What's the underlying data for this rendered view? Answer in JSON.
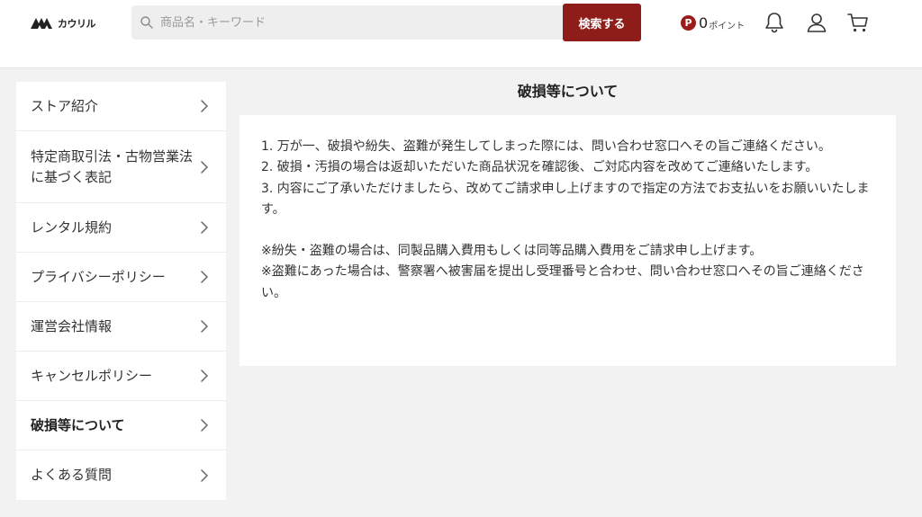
{
  "header": {
    "logo_text": "カウリル",
    "search_placeholder": "商品名・キーワード",
    "search_button": "検索する",
    "points_badge": "P",
    "points_value": "0",
    "points_unit": "ポイント"
  },
  "sidebar": {
    "items": [
      {
        "label": "ストア紹介"
      },
      {
        "label": "特定商取引法・古物営業法に基づく表記"
      },
      {
        "label": "レンタル規約"
      },
      {
        "label": "プライバシーポリシー"
      },
      {
        "label": "運営会社情報"
      },
      {
        "label": "キャンセルポリシー"
      },
      {
        "label": "破損等について"
      },
      {
        "label": "よくある質問"
      }
    ],
    "active_index": 6
  },
  "main": {
    "title": "破損等について",
    "paragraphs": [
      "1. 万が一、破損や紛失、盗難が発生してしまった際には、問い合わせ窓口へその旨ご連絡ください。",
      "2. 破損・汚損の場合は返却いただいた商品状況を確認後、ご対応内容を改めてご連絡いたします。",
      "3. 内容にご了承いただけましたら、改めてご請求申し上げますので指定の方法でお支払いをお願いいたします。",
      "※紛失・盗難の場合は、同製品購入費用もしくは同等品購入費用をご請求申し上げます。",
      "※盗難にあった場合は、警察署へ被害届を提出し受理番号と合わせ、問い合わせ窓口へその旨ご連絡ください。"
    ]
  },
  "colors": {
    "brand_red": "#8e1c19",
    "background": "#f2f2f2"
  }
}
